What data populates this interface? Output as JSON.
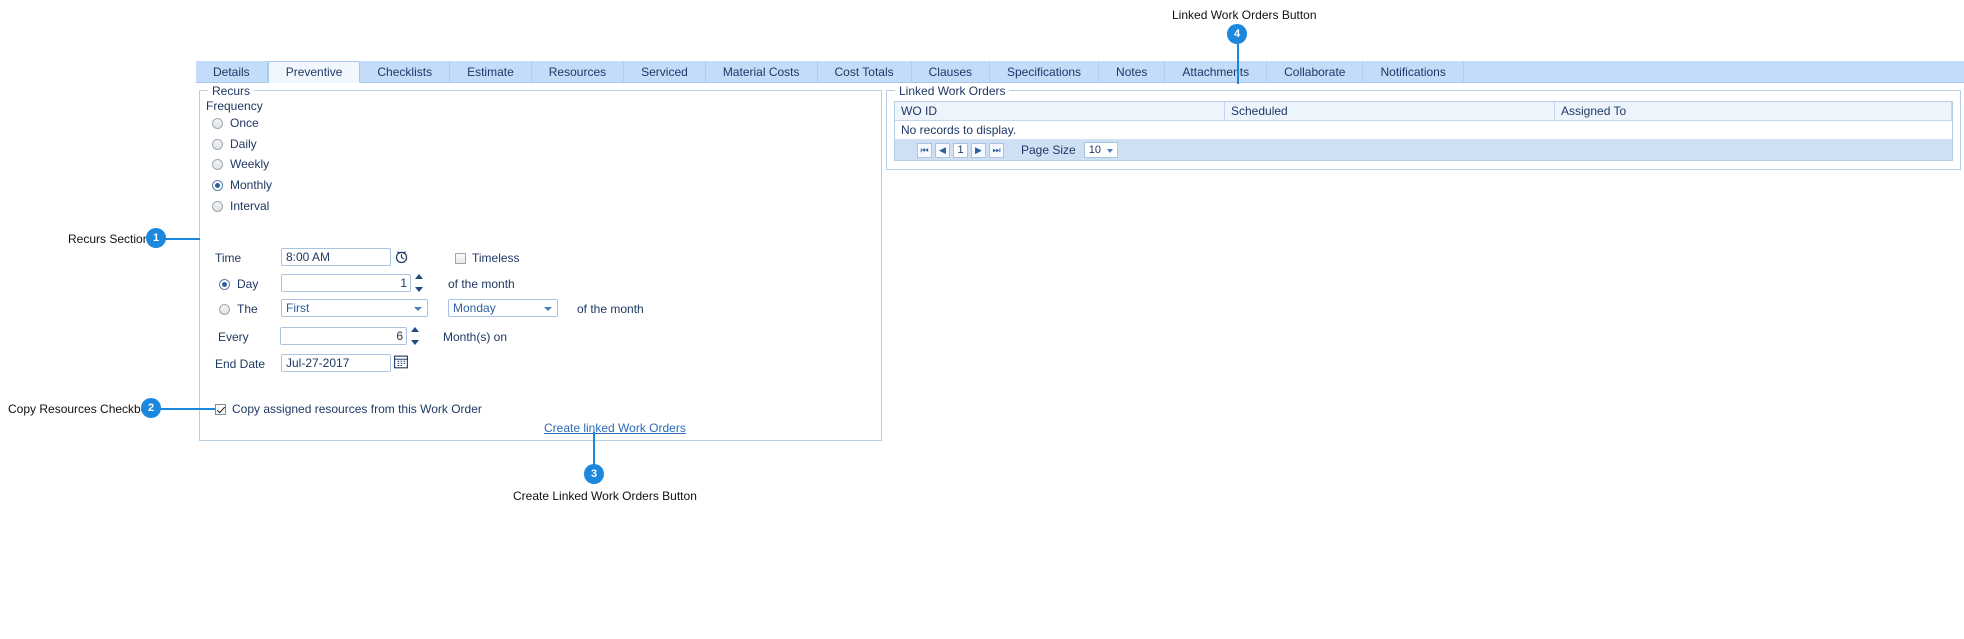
{
  "tabs": [
    {
      "label": "Details",
      "active": false
    },
    {
      "label": "Preventive",
      "active": true
    },
    {
      "label": "Checklists",
      "active": false
    },
    {
      "label": "Estimate",
      "active": false
    },
    {
      "label": "Resources",
      "active": false
    },
    {
      "label": "Serviced",
      "active": false
    },
    {
      "label": "Material Costs",
      "active": false
    },
    {
      "label": "Cost Totals",
      "active": false
    },
    {
      "label": "Clauses",
      "active": false
    },
    {
      "label": "Specifications",
      "active": false
    },
    {
      "label": "Notes",
      "active": false
    },
    {
      "label": "Attachments",
      "active": false
    },
    {
      "label": "Collaborate",
      "active": false
    },
    {
      "label": "Notifications",
      "active": false
    }
  ],
  "recurs": {
    "group_title": "Recurs",
    "frequency_label": "Frequency",
    "frequency_options": [
      {
        "label": "Once",
        "selected": false
      },
      {
        "label": "Daily",
        "selected": false
      },
      {
        "label": "Weekly",
        "selected": false
      },
      {
        "label": "Monthly",
        "selected": true
      },
      {
        "label": "Interval",
        "selected": false
      }
    ],
    "time_label": "Time",
    "time_value": "8:00 AM",
    "clock_icon": "clock-icon",
    "timeless_label": "Timeless",
    "timeless_checked": false,
    "day_label": "Day",
    "day_selected": true,
    "day_value": "1",
    "day_suffix": "of the month",
    "the_label": "The",
    "the_selected": false,
    "ordinal_value": "First",
    "weekday_value": "Monday",
    "the_suffix": "of the month",
    "every_label": "Every",
    "every_value": "6",
    "every_suffix": "Month(s) on",
    "end_date_label": "End Date",
    "end_date_value": "Jul-27-2017",
    "calendar_icon": "calendar-icon",
    "copy_resources_label": "Copy assigned resources from this Work Order",
    "copy_resources_checked": true,
    "create_link_label": "Create linked Work Orders"
  },
  "linked_work_orders": {
    "group_title": "Linked Work Orders",
    "columns": [
      "WO ID",
      "Scheduled",
      "Assigned To"
    ],
    "empty_text": "No records to display.",
    "pager": {
      "first_icon": "⏮",
      "prev_icon": "◀",
      "next_icon": "▶",
      "last_icon": "⏭",
      "current_page": "1",
      "page_size_label": "Page Size",
      "page_size_value": "10"
    }
  },
  "annotations": [
    {
      "number": "1",
      "label": "Recurs Section"
    },
    {
      "number": "2",
      "label": "Copy Resources Checkbox"
    },
    {
      "number": "3",
      "label": "Create Linked Work Orders Button"
    },
    {
      "number": "4",
      "label": "Linked Work Orders Button"
    }
  ],
  "colors": {
    "accent": "#1b87dd",
    "tab_bar": "#c3dcfa",
    "link": "#2b6cb8",
    "text": "#1f3864"
  }
}
